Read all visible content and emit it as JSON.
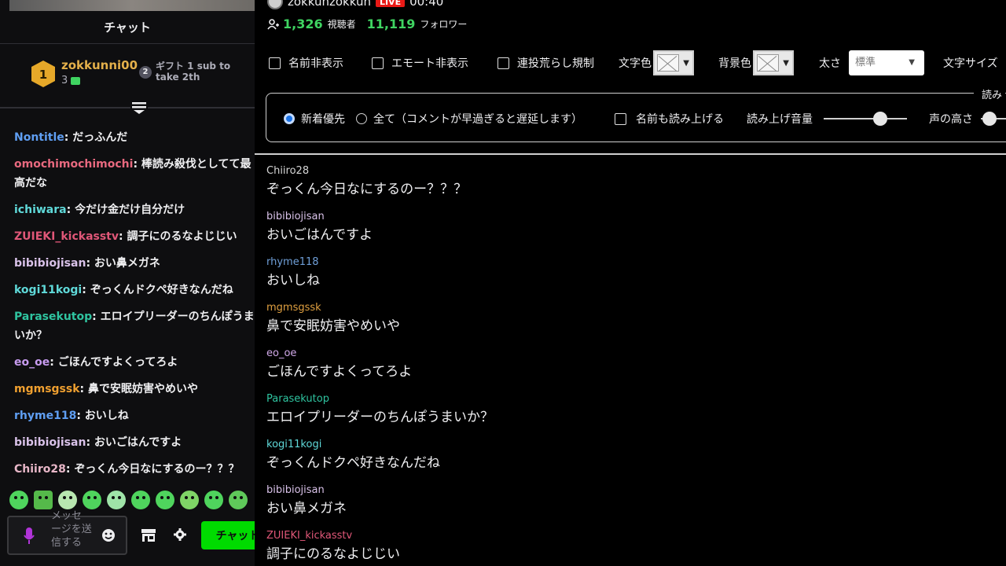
{
  "left": {
    "header_title": "チャット",
    "gift": {
      "user": "zokkunni00",
      "rank": "1",
      "count": "3",
      "next_rank": "2",
      "next_text": "ギフト 1 sub to take 2th"
    },
    "messages": [
      {
        "user": "Nontitle",
        "text": "だっふんだ",
        "color": "#5f9ef2"
      },
      {
        "user": "omochimochimochi",
        "text": "棒読み殺伐としてて最高だな",
        "color": "#e8697f"
      },
      {
        "user": "ichiwara",
        "text": "今だけ金だけ自分だけ",
        "color": "#5fd9d9"
      },
      {
        "user": "ZUIEKI_kickasstv",
        "text": "調子にのるなよじじい",
        "color": "#e05778"
      },
      {
        "user": "bibibiojisan",
        "text": "おい鼻メガネ",
        "color": "#d9c2e9"
      },
      {
        "user": "kogi11kogi",
        "text": "ぞっくんドクペ好きなんだね",
        "color": "#5fd9d9"
      },
      {
        "user": "Parasekutop",
        "text": "エロイプリーダーのちんぽうまいか？",
        "color": "#2fc4a0"
      },
      {
        "user": "eo_oe",
        "text": "ごほんですよくってろよ",
        "color": "#c89cf0"
      },
      {
        "user": "mgmsgssk",
        "text": "鼻で安眠妨害やめいや",
        "color": "#f0a030"
      },
      {
        "user": "rhyme118",
        "text": "おいしね",
        "color": "#5f9ef2"
      },
      {
        "user": "bibibiojisan",
        "text": "おいごはんですよ",
        "color": "#d9c2e9"
      },
      {
        "user": "Chiiro28",
        "text": "ぞっくん今日なにするのー？？？",
        "color": "#e8b7c8"
      }
    ],
    "input_placeholder": "メッセージを送信する",
    "chat_button": "チャット"
  },
  "stream": {
    "channel": "zokkunzokkun",
    "live_label": "LIVE",
    "uptime": "00:40",
    "viewers": "1,326",
    "viewers_label": "視聴者",
    "followers": "11,119",
    "followers_label": "フォロワー"
  },
  "options": {
    "hide_names": "名前非表示",
    "hide_emotes": "エモート非表示",
    "spam_filter": "連投荒らし規制",
    "text_color": "文字色",
    "bg_color": "背景色",
    "weight": "太さ",
    "weight_value": "標準",
    "font_size": "文字サイズ"
  },
  "tts": {
    "legend": "読み",
    "newest_first": "新着優先",
    "all": "全て（コメントが早過ぎると遅延します）",
    "read_names": "名前も読み上げる",
    "volume": "読み上げ音量",
    "volume_value": 0.72,
    "pitch": "声の高さ"
  },
  "feed": [
    {
      "user": "Chiiro28",
      "text": "ぞっくん今日なにするのー？？？",
      "color": "#d6d6d6"
    },
    {
      "user": "bibibiojisan",
      "text": "おいごはんですよ",
      "color": "#d9c2e9"
    },
    {
      "user": "rhyme118",
      "text": "おいしね",
      "color": "#6f9fd8"
    },
    {
      "user": "mgmsgssk",
      "text": "鼻で安眠妨害やめいや",
      "color": "#e0a040"
    },
    {
      "user": "eo_oe",
      "text": "ごほんですよくってろよ",
      "color": "#d0a8e8"
    },
    {
      "user": "Parasekutop",
      "text": "エロイプリーダーのちんぽうまいか？",
      "color": "#2fc4a0"
    },
    {
      "user": "kogi11kogi",
      "text": "ぞっくんドクペ好きなんだね",
      "color": "#5fd9d9"
    },
    {
      "user": "bibibiojisan",
      "text": "おい鼻メガネ",
      "color": "#d9c2e9"
    },
    {
      "user": "ZUIEKI_kickasstv",
      "text": "調子にのるなよじじい",
      "color": "#e05778"
    }
  ],
  "colors": {
    "accent_green": "#00db00",
    "count_green": "#3fd461",
    "live_red": "#e91916",
    "radio_blue": "#1a73e8"
  }
}
